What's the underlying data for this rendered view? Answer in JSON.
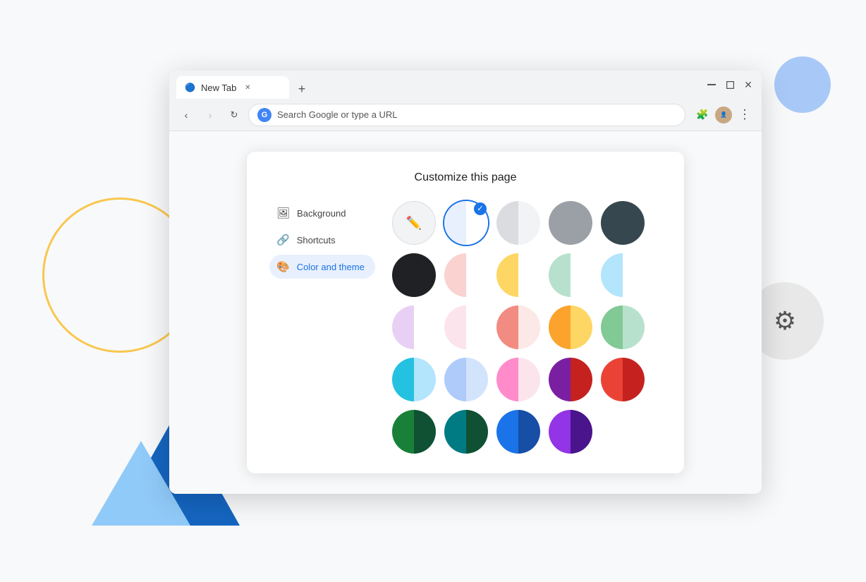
{
  "browser": {
    "tab_title": "New Tab",
    "address_placeholder": "Search Google or type a URL",
    "address_text": "Search Google or type a URL"
  },
  "panel": {
    "title": "Customize this page",
    "nav_items": [
      {
        "id": "background",
        "label": "Background",
        "icon": "🖼",
        "active": false
      },
      {
        "id": "shortcuts",
        "label": "Shortcuts",
        "icon": "🔗",
        "active": false
      },
      {
        "id": "color-and-theme",
        "label": "Color and theme",
        "icon": "🎨",
        "active": true
      }
    ]
  },
  "colors": {
    "row1": [
      {
        "id": "custom",
        "type": "custom",
        "icon": "✏️"
      },
      {
        "id": "white-selected",
        "type": "split",
        "left": "#e8f0fe",
        "right": "#fff",
        "selected": true
      },
      {
        "id": "gray-light",
        "type": "solid",
        "color": "#dadce0"
      },
      {
        "id": "gray-mid",
        "type": "solid",
        "color": "#9aa0a6"
      },
      {
        "id": "dark-teal",
        "type": "solid",
        "color": "#37474f"
      },
      {
        "id": "black",
        "type": "solid",
        "color": "#202124"
      }
    ],
    "row2": [
      {
        "id": "peach-light",
        "type": "split",
        "left": "#fce8e6",
        "right": "#fff"
      },
      {
        "id": "yellow-half",
        "type": "split",
        "left": "#fdd663",
        "right": "#fff"
      },
      {
        "id": "green-light",
        "type": "split",
        "left": "#d2e3fc",
        "right": "#e6f4ea"
      },
      {
        "id": "teal-light",
        "type": "split",
        "left": "#bfe1f6",
        "right": "#fff"
      },
      {
        "id": "pink-light",
        "type": "split",
        "left": "#fce8e6",
        "right": "#fce8f0"
      },
      {
        "id": "pink-mid",
        "type": "split",
        "left": "#fad2cf",
        "right": "#fff"
      }
    ],
    "row3": [
      {
        "id": "salmon",
        "type": "split",
        "left": "#f28b82",
        "right": "#fce8e6"
      },
      {
        "id": "orange",
        "type": "split",
        "left": "#fba32c",
        "right": "#fdd663"
      },
      {
        "id": "green-mid",
        "type": "split",
        "left": "#81c995",
        "right": "#d2e3fc"
      },
      {
        "id": "teal-mid",
        "type": "split",
        "left": "#24c1e0",
        "right": "#bfe1f6"
      },
      {
        "id": "blue-lavender",
        "type": "split",
        "left": "#aecbfa",
        "right": "#d2e3fc"
      },
      {
        "id": "pink-hot",
        "type": "split",
        "left": "#ff8bcb",
        "right": "#fad2cf"
      }
    ],
    "row4": [
      {
        "id": "maroon",
        "type": "split",
        "left": "#c5221f",
        "right": "#7b1fa2"
      },
      {
        "id": "red",
        "type": "split",
        "left": "#ea4335",
        "right": "#c5221f"
      },
      {
        "id": "forest",
        "type": "split",
        "left": "#188038",
        "right": "#0f5132"
      },
      {
        "id": "dark-teal2",
        "type": "split",
        "left": "#007b83",
        "right": "#0f5132"
      },
      {
        "id": "navy",
        "type": "split",
        "left": "#1a73e8",
        "right": "#174ea6"
      },
      {
        "id": "purple",
        "type": "split",
        "left": "#9334e6",
        "right": "#4a148c"
      }
    ]
  },
  "decorative": {
    "gear_icon": "⚙"
  }
}
